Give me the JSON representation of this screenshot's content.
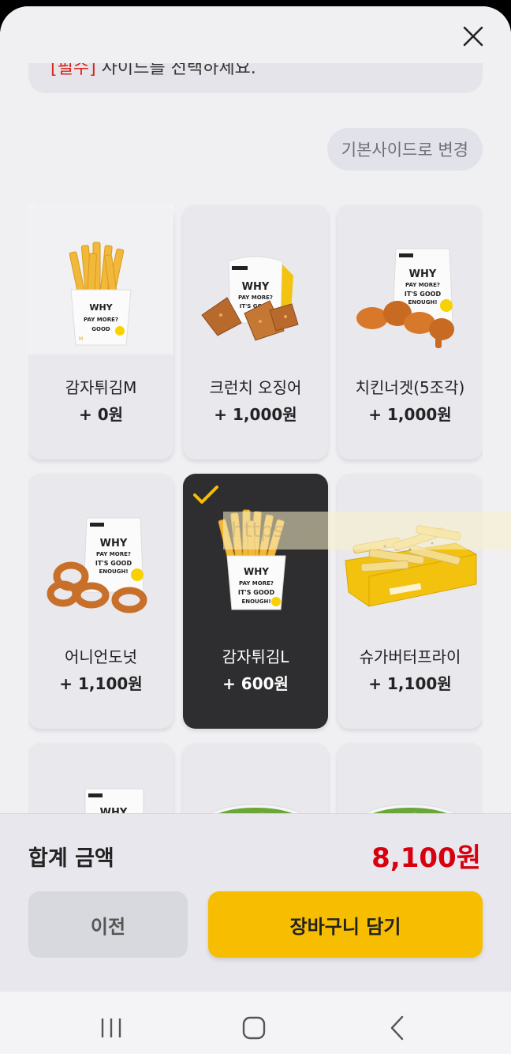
{
  "header": {
    "notice_prefix": "[필수]",
    "notice_text": " 사이드를 선택하세요.",
    "close_icon": "close-icon"
  },
  "default_side_button": "기본사이드로 변경",
  "items": [
    {
      "name": "감자튀김M",
      "price": "+ 0원",
      "selected": false,
      "icon": "fries-box-icon"
    },
    {
      "name": "크런치 오징어",
      "price": "+ 1,000원",
      "selected": false,
      "icon": "crunchy-squid-icon"
    },
    {
      "name": "치킨너겟(5조각)",
      "price": "+ 1,000원",
      "selected": false,
      "icon": "chicken-nugget-icon"
    },
    {
      "name": "어니언도넛",
      "price": "+ 1,100원",
      "selected": false,
      "icon": "onion-ring-icon"
    },
    {
      "name": "감자튀김L",
      "price": "+ 600원",
      "selected": true,
      "icon": "fries-box-icon"
    },
    {
      "name": "슈가버터프라이",
      "price": "+ 1,100원",
      "selected": false,
      "icon": "sugar-butter-fries-icon"
    },
    {
      "name": "",
      "price": "",
      "selected": false,
      "icon": "side-box-icon"
    },
    {
      "name": "",
      "price": "",
      "selected": false,
      "icon": "salad-icon"
    },
    {
      "name": "",
      "price": "",
      "selected": false,
      "icon": "salad-icon"
    }
  ],
  "box_text": "WHY PAY MORE? It's GOOD ENOUGH!",
  "watermark": "https://je",
  "footer": {
    "total_label": "합계 금액",
    "total_value": "8,100원",
    "prev_button": "이전",
    "cart_button": "장바구니 담기"
  },
  "colors": {
    "accent": "#f7bd00",
    "price_red": "#d7000f",
    "selected_card": "#2e2e30"
  }
}
